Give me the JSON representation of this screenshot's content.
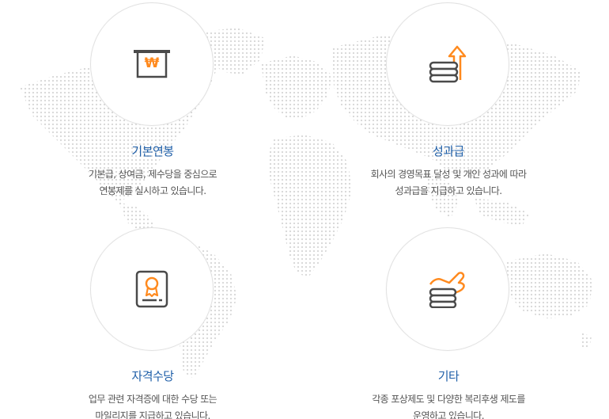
{
  "colors": {
    "title": "#1f5fa8",
    "text": "#555555",
    "accent": "#ff8a1e",
    "icon": "#4a4a4a",
    "map_dot": "#d8d8d8"
  },
  "benefits": [
    {
      "icon": "won-register-icon",
      "title": "기본연봉",
      "desc_line1": "기본급, 상여금, 제수당을 중심으로",
      "desc_line2": "연봉제를 실시하고 있습니다."
    },
    {
      "icon": "coins-arrow-up-icon",
      "title": "성과급",
      "desc_line1": "회사의 경영목표 달성 및 개인 성과에 따라",
      "desc_line2": "성과급을 지급하고 있습니다."
    },
    {
      "icon": "certificate-icon",
      "title": "자격수당",
      "desc_line1": "업무 관련 자격증에 대한 수당 또는",
      "desc_line2": "마일리지를 지급하고 있습니다."
    },
    {
      "icon": "coins-hand-icon",
      "title": "기타",
      "desc_line1": "각종 포상제도 및 다양한 복리후생 제도를",
      "desc_line2": "운영하고 있습니다."
    }
  ]
}
